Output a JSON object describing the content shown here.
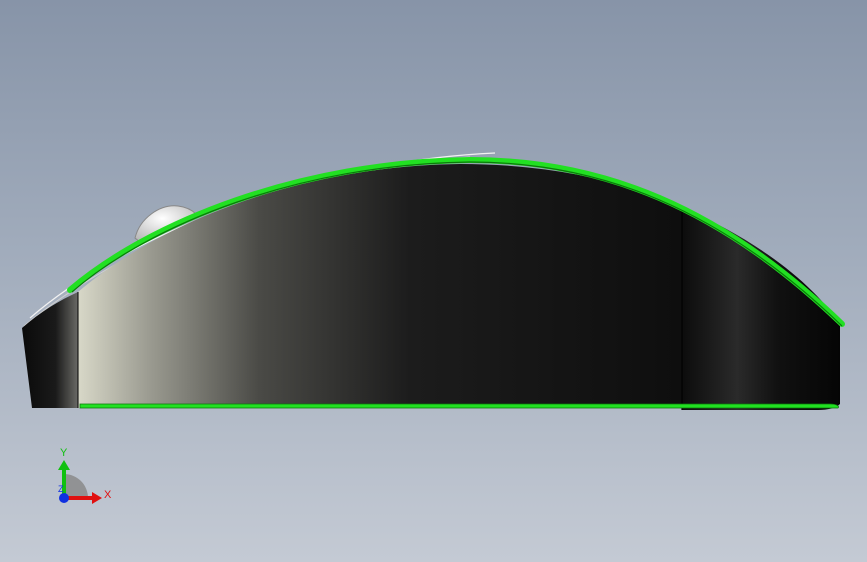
{
  "viewport": {
    "background_top": "#8794a8",
    "background_bottom": "#c4cad4"
  },
  "model": {
    "shape": "computer-mouse-side-view",
    "body_color": "#111111",
    "edge_highlight_color": "#22e022",
    "wheel_color": "#e8e8e8"
  },
  "triad": {
    "y_label": "Y",
    "x_label": "X",
    "z_label": "Z",
    "x_color": "#e01010",
    "y_color": "#10c010",
    "z_color": "#1030e0"
  }
}
